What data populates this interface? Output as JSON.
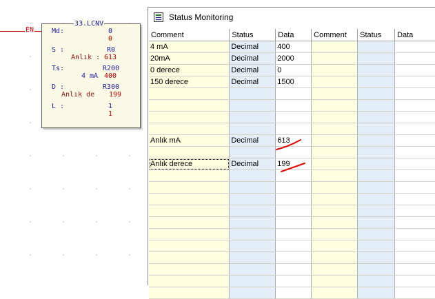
{
  "ladder": {
    "en_label": "EN",
    "block": {
      "title": "33.LCNV",
      "rows": [
        {
          "label": "Md:",
          "value": "0",
          "sub_value": "0"
        },
        {
          "label": "S :",
          "value": "R0",
          "comment": "Anlık :",
          "sub_value": "613"
        },
        {
          "label": "Ts:",
          "value": "R200",
          "comment": "4 mA",
          "sub_value": "400"
        },
        {
          "label": "D :",
          "value": "R300",
          "comment": "Anlık de",
          "sub_value": "199"
        },
        {
          "label": "L :",
          "value": "1",
          "sub_value": "1"
        }
      ]
    }
  },
  "window": {
    "title": "Status Monitoring",
    "columns": [
      "Comment",
      "Status",
      "Data",
      "Comment",
      "Status",
      "Data"
    ],
    "rows": [
      {
        "comment": "4 mA",
        "status": "Decimal",
        "data": "400"
      },
      {
        "comment": "20mA",
        "status": "Decimal",
        "data": "2000"
      },
      {
        "comment": "0 derece",
        "status": "Decimal",
        "data": "0"
      },
      {
        "comment": "150 derece",
        "status": "Decimal",
        "data": "1500"
      },
      {
        "comment": "",
        "status": "",
        "data": ""
      },
      {
        "comment": "",
        "status": "",
        "data": ""
      },
      {
        "comment": "",
        "status": "",
        "data": ""
      },
      {
        "comment": "",
        "status": "",
        "data": ""
      },
      {
        "comment": "Anlık mA",
        "status": "Decimal",
        "data": "613"
      },
      {
        "comment": "",
        "status": "",
        "data": ""
      },
      {
        "comment": "Anlık derece",
        "status": "Decimal",
        "data": "199"
      },
      {
        "comment": "",
        "status": "",
        "data": ""
      },
      {
        "comment": "",
        "status": "",
        "data": ""
      },
      {
        "comment": "",
        "status": "",
        "data": ""
      },
      {
        "comment": "",
        "status": "",
        "data": ""
      },
      {
        "comment": "",
        "status": "",
        "data": ""
      },
      {
        "comment": "",
        "status": "",
        "data": ""
      },
      {
        "comment": "",
        "status": "",
        "data": ""
      },
      {
        "comment": "",
        "status": "",
        "data": ""
      },
      {
        "comment": "",
        "status": "",
        "data": ""
      },
      {
        "comment": "",
        "status": "",
        "data": ""
      },
      {
        "comment": "",
        "status": "",
        "data": ""
      }
    ],
    "selected_row": 10,
    "annotation_color": "#e00000"
  }
}
